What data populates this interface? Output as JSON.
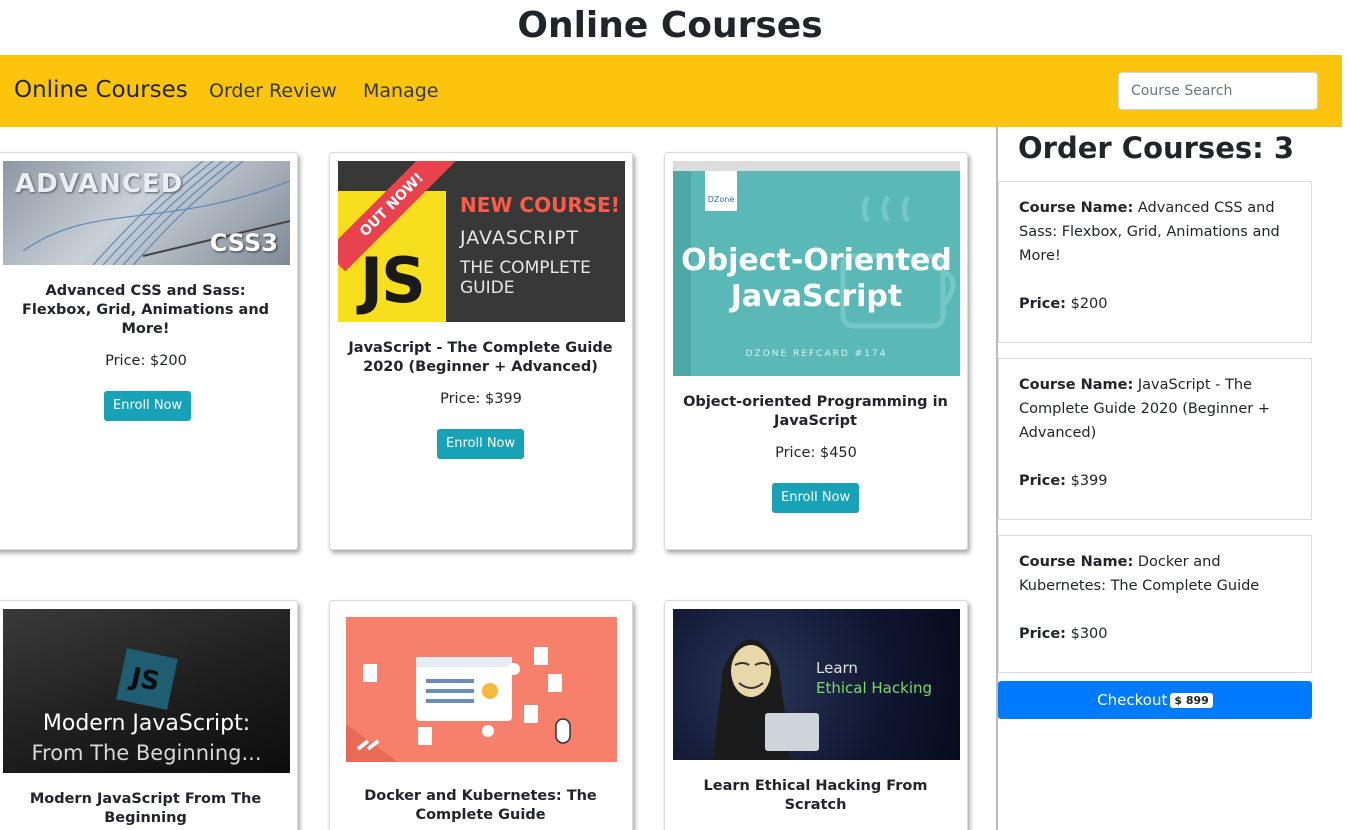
{
  "page_title": "Online Courses",
  "navbar": {
    "brand": "Online Courses",
    "links": [
      "Order Review",
      "Manage"
    ],
    "search_placeholder": "Course Search"
  },
  "courses": [
    {
      "image_label": "ADVANCED",
      "image_sub": "CSS3",
      "title": "Advanced CSS and Sass: Flexbox, Grid, Animations and More!",
      "price": "Price: $200",
      "button": "Enroll Now"
    },
    {
      "image_banner": "OUT NOW!",
      "image_label": "NEW COURSE!",
      "image_line1": "JAVASCRIPT",
      "image_line2": "THE COMPLETE GUIDE",
      "image_mark": "JS",
      "title": "JavaScript - The Complete Guide 2020 (Beginner + Advanced)",
      "price": "Price: $399",
      "button": "Enroll Now"
    },
    {
      "image_logo": "DZone",
      "image_line1": "Object-Oriented",
      "image_line2": "JavaScript",
      "image_sub": "DZONE REFCARD #174",
      "title": "Object-oriented Programming in JavaScript",
      "price": "Price: $450",
      "button": "Enroll Now"
    },
    {
      "image_mark": "JS",
      "image_line1": "Modern JavaScript:",
      "image_line2": "From The Beginning...",
      "title": "Modern JavaScript From The Beginning",
      "price": "",
      "button": ""
    },
    {
      "title": "Docker and Kubernetes: The Complete Guide",
      "price": "",
      "button": ""
    },
    {
      "image_line1": "Learn",
      "image_line2": "Ethical Hacking",
      "title": "Learn Ethical Hacking From Scratch",
      "price": "",
      "button": ""
    }
  ],
  "order": {
    "title": "Order Courses: 3",
    "name_label": "Course Name:",
    "price_label": "Price:",
    "items": [
      {
        "name": "Advanced CSS and Sass: Flexbox, Grid, Animations and More!",
        "price": "$200"
      },
      {
        "name": "JavaScript - The Complete Guide 2020 (Beginner + Advanced)",
        "price": "$399"
      },
      {
        "name": "Docker and Kubernetes: The Complete Guide",
        "price": "$300"
      }
    ],
    "checkout_label": "Checkout",
    "checkout_total": "$ 899"
  },
  "colors": {
    "navbar": "#fcc40c",
    "enroll": "#17a2b8",
    "checkout": "#007bff"
  }
}
